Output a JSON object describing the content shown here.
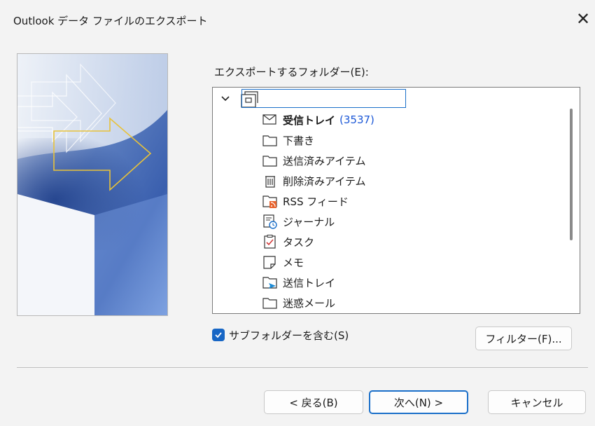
{
  "dialog": {
    "title": "Outlook データ ファイルのエクスポート",
    "close_glyph": "✕"
  },
  "folder_section": {
    "label": "エクスポートするフォルダー(E):",
    "root_icon": "mailbox-icon",
    "items": [
      {
        "label": "受信トレイ",
        "count": "(3537)",
        "icon": "envelope-icon"
      },
      {
        "label": "下書き",
        "icon": "folder-icon"
      },
      {
        "label": "送信済みアイテム",
        "icon": "folder-icon"
      },
      {
        "label": "削除済みアイテム",
        "icon": "trash-icon"
      },
      {
        "label": "RSS フィード",
        "icon": "rss-folder-icon"
      },
      {
        "label": "ジャーナル",
        "icon": "journal-icon"
      },
      {
        "label": "タスク",
        "icon": "task-icon"
      },
      {
        "label": "メモ",
        "icon": "note-icon"
      },
      {
        "label": "送信トレイ",
        "icon": "outbox-icon"
      },
      {
        "label": "迷惑メール",
        "icon": "folder-icon"
      }
    ]
  },
  "options": {
    "include_subfolders_label": "サブフォルダーを含む(S)",
    "include_subfolders_checked": true,
    "filter_button": "フィルター(F)..."
  },
  "footer": {
    "back_button": "< 戻る(B)",
    "next_button": "次へ(N) >",
    "cancel_button": "キャンセル"
  },
  "colors": {
    "accent": "#1a6fc9",
    "count": "#1a56d6",
    "checkbox": "#1766c5",
    "arrow_outline": "#e8c23a"
  }
}
